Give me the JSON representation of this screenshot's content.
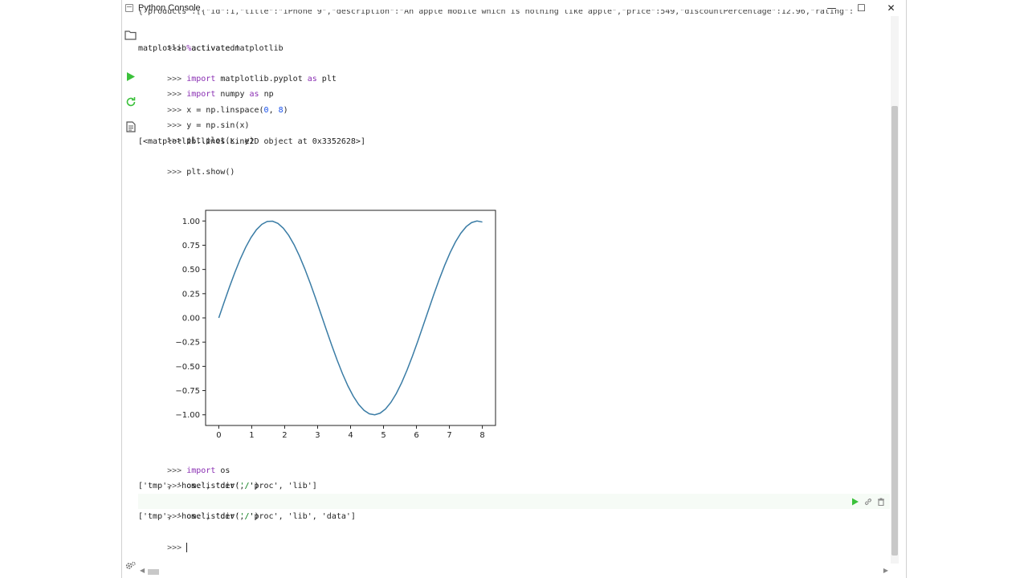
{
  "window": {
    "title": "Python Console",
    "controls": {
      "minimize": "—",
      "maximize": "☐",
      "close": "✕"
    }
  },
  "sidebar": {
    "icons": [
      "folder-icon",
      "run-icon",
      "rerun-icon",
      "document-icon",
      "settings-icon"
    ]
  },
  "console": {
    "prompt": ">>>",
    "top_cutoff": "{\"products\":[{\"id\":1,\"title\":\"iPhone 9\",\"description\":\"An apple mobile which is nothing like apple\",\"price\":549,\"discountPercentage\":12.96,\"rating\":",
    "lines": [
      {
        "type": "input",
        "text": "%activate matplotlib"
      },
      {
        "type": "output",
        "text": "matplotlib activated!"
      },
      {
        "type": "input",
        "text": "import matplotlib.pyplot as plt"
      },
      {
        "type": "input",
        "text": "import numpy as np"
      },
      {
        "type": "input",
        "text": "x = np.linspace(0, 8)"
      },
      {
        "type": "input",
        "text": "y = np.sin(x)"
      },
      {
        "type": "input",
        "text": "plt.plot(x, y)"
      },
      {
        "type": "output",
        "text": "[<matplotlib.lines.Line2D object at 0x3352628>]"
      },
      {
        "type": "input",
        "text": "plt.show()"
      },
      {
        "type": "input",
        "text": "import os"
      },
      {
        "type": "input",
        "text": "os.listdir('/')"
      },
      {
        "type": "output",
        "text": "['tmp', 'home', 'dev', 'proc', 'lib']"
      },
      {
        "type": "input",
        "text": "os.listdir('/')"
      },
      {
        "type": "output",
        "text": "['tmp', 'home', 'dev', 'proc', 'lib', 'data']"
      }
    ]
  },
  "chart_data": {
    "type": "line",
    "x_range": [
      0,
      8
    ],
    "xticks": [
      "0",
      "1",
      "2",
      "3",
      "4",
      "5",
      "6",
      "7",
      "8"
    ],
    "yticks": [
      "1.00",
      "0.75",
      "0.50",
      "0.25",
      "0.00",
      "−0.25",
      "−0.50",
      "−0.75",
      "−1.00"
    ],
    "ylim": [
      -1.0,
      1.0
    ],
    "series": [
      {
        "function": "sin(x)",
        "x_start": 0,
        "x_end": 8,
        "num_points": 50,
        "color": "#3a7ca5"
      }
    ],
    "grid": false
  },
  "colors": {
    "keyword": "#8a2fb3",
    "number": "#1750eb",
    "string": "#067d17",
    "run_green": "#3bc13b",
    "line_blue": "#3a7ca5"
  }
}
